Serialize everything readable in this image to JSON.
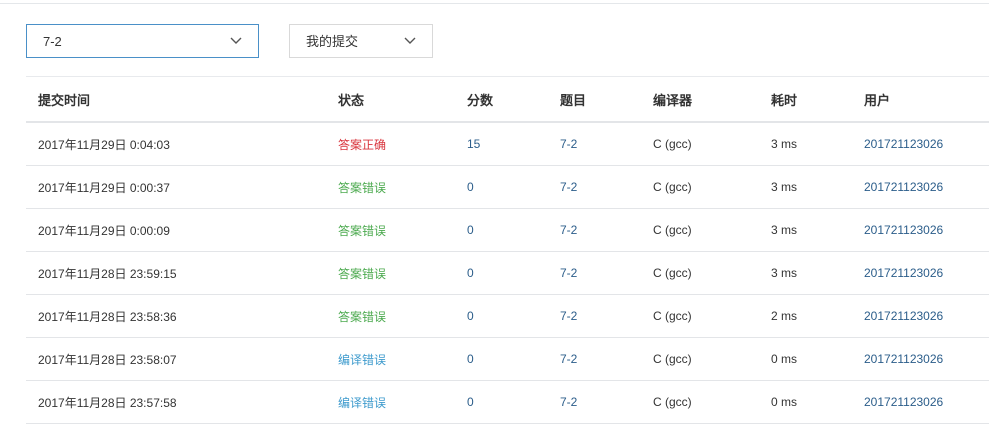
{
  "filters": {
    "problem_select": {
      "value": "7-2"
    },
    "scope_select": {
      "value": "我的提交"
    }
  },
  "table": {
    "headers": {
      "time": "提交时间",
      "status": "状态",
      "score": "分数",
      "problem": "题目",
      "compiler": "编译器",
      "cost": "耗时",
      "user": "用户"
    },
    "rows": [
      {
        "time": "2017年11月29日 0:04:03",
        "status": "答案正确",
        "status_type": "correct",
        "score": "15",
        "problem": "7-2",
        "compiler": "C (gcc)",
        "cost": "3 ms",
        "user": "201721123026"
      },
      {
        "time": "2017年11月29日 0:00:37",
        "status": "答案错误",
        "status_type": "wrong",
        "score": "0",
        "problem": "7-2",
        "compiler": "C (gcc)",
        "cost": "3 ms",
        "user": "201721123026"
      },
      {
        "time": "2017年11月29日 0:00:09",
        "status": "答案错误",
        "status_type": "wrong",
        "score": "0",
        "problem": "7-2",
        "compiler": "C (gcc)",
        "cost": "3 ms",
        "user": "201721123026"
      },
      {
        "time": "2017年11月28日 23:59:15",
        "status": "答案错误",
        "status_type": "wrong",
        "score": "0",
        "problem": "7-2",
        "compiler": "C (gcc)",
        "cost": "3 ms",
        "user": "201721123026"
      },
      {
        "time": "2017年11月28日 23:58:36",
        "status": "答案错误",
        "status_type": "wrong",
        "score": "0",
        "problem": "7-2",
        "compiler": "C (gcc)",
        "cost": "2 ms",
        "user": "201721123026"
      },
      {
        "time": "2017年11月28日 23:58:07",
        "status": "编译错误",
        "status_type": "compile_error",
        "score": "0",
        "problem": "7-2",
        "compiler": "C (gcc)",
        "cost": "0 ms",
        "user": "201721123026"
      },
      {
        "time": "2017年11月28日 23:57:58",
        "status": "编译错误",
        "status_type": "compile_error",
        "score": "0",
        "problem": "7-2",
        "compiler": "C (gcc)",
        "cost": "0 ms",
        "user": "201721123026"
      }
    ]
  },
  "colors": {
    "correct": "#d9363e",
    "wrong": "#4caa4f",
    "compile_error": "#3e9bcd",
    "link": "#2b5d8a",
    "select_focus_border": "#4a90c8"
  },
  "icons": {
    "dropdown": "chevron-down-icon"
  }
}
